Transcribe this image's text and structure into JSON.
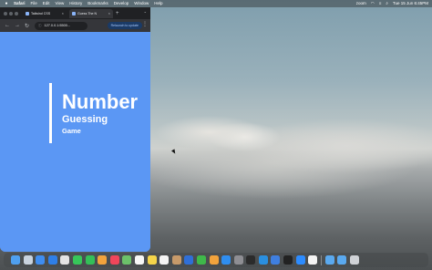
{
  "menubar": {
    "app_name": "Safari",
    "items": [
      "File",
      "Edit",
      "View",
      "History",
      "Bookmarks",
      "Develop",
      "Window",
      "Help"
    ],
    "status": {
      "zoom_label": "zoom",
      "datetime": "Tue 15 Jun 6:45PM"
    }
  },
  "browser": {
    "tabs": [
      {
        "label": "Tailwind CSS"
      },
      {
        "label": "Guess The N"
      }
    ],
    "new_tab_label": "+",
    "url": "127.0.0.1:5500...",
    "relaunch_label": "Relaunch to update",
    "more_label": "⋮",
    "tab_list_label": "⌄"
  },
  "page": {
    "title_main": "Number",
    "title_sub": "Guessing",
    "title_sub2": "Game"
  },
  "colors": {
    "page_background": "#5b97f4",
    "title_text": "#ffffff"
  },
  "dock": {
    "icons": [
      {
        "name": "finder-icon",
        "color": "#4fa0f0"
      },
      {
        "name": "launchpad-icon",
        "color": "#c9d3de"
      },
      {
        "name": "mail-icon",
        "color": "#3f8df0"
      },
      {
        "name": "safari-icon",
        "color": "#2f7fe8"
      },
      {
        "name": "chrome-icon",
        "color": "#e4e4e4"
      },
      {
        "name": "messages-icon",
        "color": "#37c75a"
      },
      {
        "name": "facetime-icon",
        "color": "#34c058"
      },
      {
        "name": "photos-icon",
        "color": "#f2a33c"
      },
      {
        "name": "music-icon",
        "color": "#f0465a"
      },
      {
        "name": "maps-icon",
        "color": "#6cc26a"
      },
      {
        "name": "calendar-icon",
        "color": "#f7f7f7"
      },
      {
        "name": "notes-icon",
        "color": "#f5d54a"
      },
      {
        "name": "reminders-icon",
        "color": "#f4f4f4"
      },
      {
        "name": "contacts-icon",
        "color": "#c79a6a"
      },
      {
        "name": "keynote-icon",
        "color": "#2f6fd8"
      },
      {
        "name": "numbers-icon",
        "color": "#3fb84a"
      },
      {
        "name": "pages-icon",
        "color": "#f2a33c"
      },
      {
        "name": "appstore-icon",
        "color": "#2f8ef0"
      },
      {
        "name": "settings-icon",
        "color": "#8e8e93"
      },
      {
        "name": "terminal-icon",
        "color": "#2b2b2b"
      },
      {
        "name": "vscode-icon",
        "color": "#2a8fe0"
      },
      {
        "name": "xcode-icon",
        "color": "#3f7fe0"
      },
      {
        "name": "github-icon",
        "color": "#222222"
      },
      {
        "name": "zoom-icon",
        "color": "#2d8cff"
      },
      {
        "name": "notion-icon",
        "color": "#f4f4f4"
      },
      {
        "name": "folder-icon",
        "color": "#5aa9ef"
      },
      {
        "name": "downloads-icon",
        "color": "#5aa9ef"
      },
      {
        "name": "trash-icon",
        "color": "#cfd2d6"
      }
    ]
  }
}
